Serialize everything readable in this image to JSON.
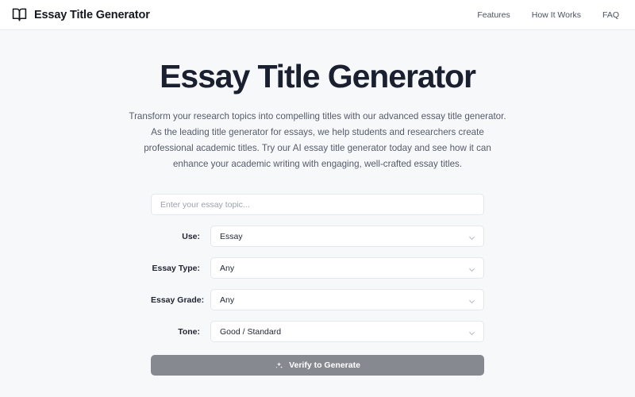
{
  "header": {
    "brand": {
      "icon": "open-book-icon",
      "name": "Essay Title Generator"
    },
    "nav": [
      {
        "label": "Features"
      },
      {
        "label": "How It Works"
      },
      {
        "label": "FAQ"
      }
    ]
  },
  "hero": {
    "title": "Essay Title Generator",
    "description": "Transform your research topics into compelling titles with our advanced essay title generator. As the leading title generator for essays, we help students and researchers create professional academic titles. Try our AI essay title generator today and see how it can enhance your academic writing with engaging, well-crafted essay titles."
  },
  "form": {
    "topic": {
      "value": "",
      "placeholder": "Enter your essay topic..."
    },
    "fields": [
      {
        "label": "Use:",
        "value": "Essay",
        "icon": "chevron-down-icon"
      },
      {
        "label": "Essay Type:",
        "value": "Any",
        "icon": "chevron-down-icon"
      },
      {
        "label": "Essay Grade:",
        "value": "Any",
        "icon": "chevron-down-icon"
      },
      {
        "label": "Tone:",
        "value": "Good / Standard",
        "icon": "chevron-down-icon"
      }
    ],
    "submit": {
      "label": "Verify to Generate",
      "icon": "sparkles-icon",
      "color": "#868a90"
    }
  },
  "colors": {
    "page_background": "#f7f8fa",
    "header_background": "#ffffff",
    "title": "#1a2030",
    "body_text": "#545b6a",
    "border": "#e4e7ec"
  }
}
